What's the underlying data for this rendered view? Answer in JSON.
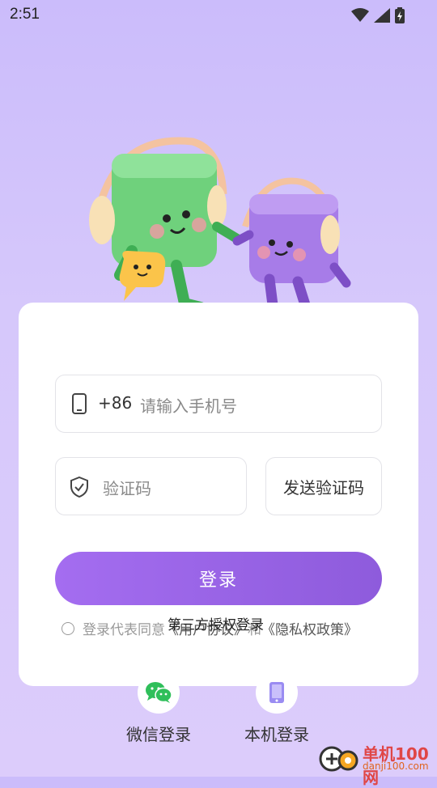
{
  "status_bar": {
    "time": "2:51"
  },
  "login_form": {
    "phone_prefix": "+86",
    "phone_placeholder": "请输入手机号",
    "code_placeholder": "验证码",
    "send_code_label": "发送验证码",
    "login_label": "登录",
    "agreement_prefix": "登录代表同意",
    "user_agreement": "《用户协议》",
    "and_text": "和",
    "privacy_policy": "《隐私权政策》"
  },
  "third_party": {
    "title": "第三方授权登录",
    "options": [
      {
        "label": "微信登录",
        "icon": "wechat-icon",
        "color": "#2fbf5a"
      },
      {
        "label": "本机登录",
        "icon": "phone-device-icon",
        "color": "#7f7fe0"
      }
    ]
  },
  "watermark": {
    "text": "单机100网",
    "url": "danji100.com"
  },
  "colors": {
    "accent": "#9c68ec",
    "background": "#cfc0fb"
  }
}
